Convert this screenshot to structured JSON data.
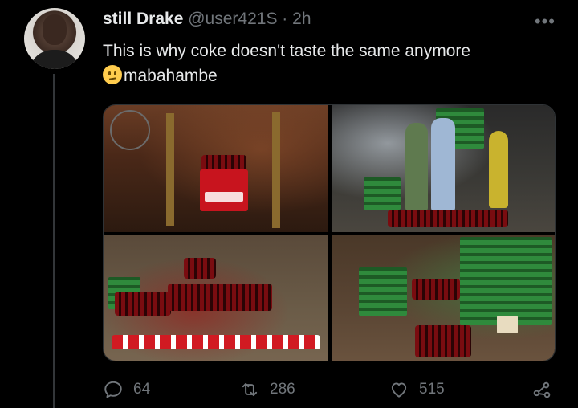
{
  "author": {
    "name": "still Drake",
    "handle": "@user421S",
    "separator": "·",
    "time": "2h"
  },
  "tweet": {
    "line1": "This is why coke doesn't taste the same anymore",
    "emoji": "confused-face-emoji",
    "line2": "mabahambe"
  },
  "media": {
    "photos": [
      {
        "id": "photo-1"
      },
      {
        "id": "photo-2"
      },
      {
        "id": "photo-3"
      },
      {
        "id": "photo-4"
      }
    ]
  },
  "actions": {
    "reply_count": "64",
    "retweet_count": "286",
    "like_count": "515"
  },
  "colors": {
    "background": "#000000",
    "text": "#e7e9ea",
    "muted": "#71767b",
    "divider": "#333639"
  }
}
